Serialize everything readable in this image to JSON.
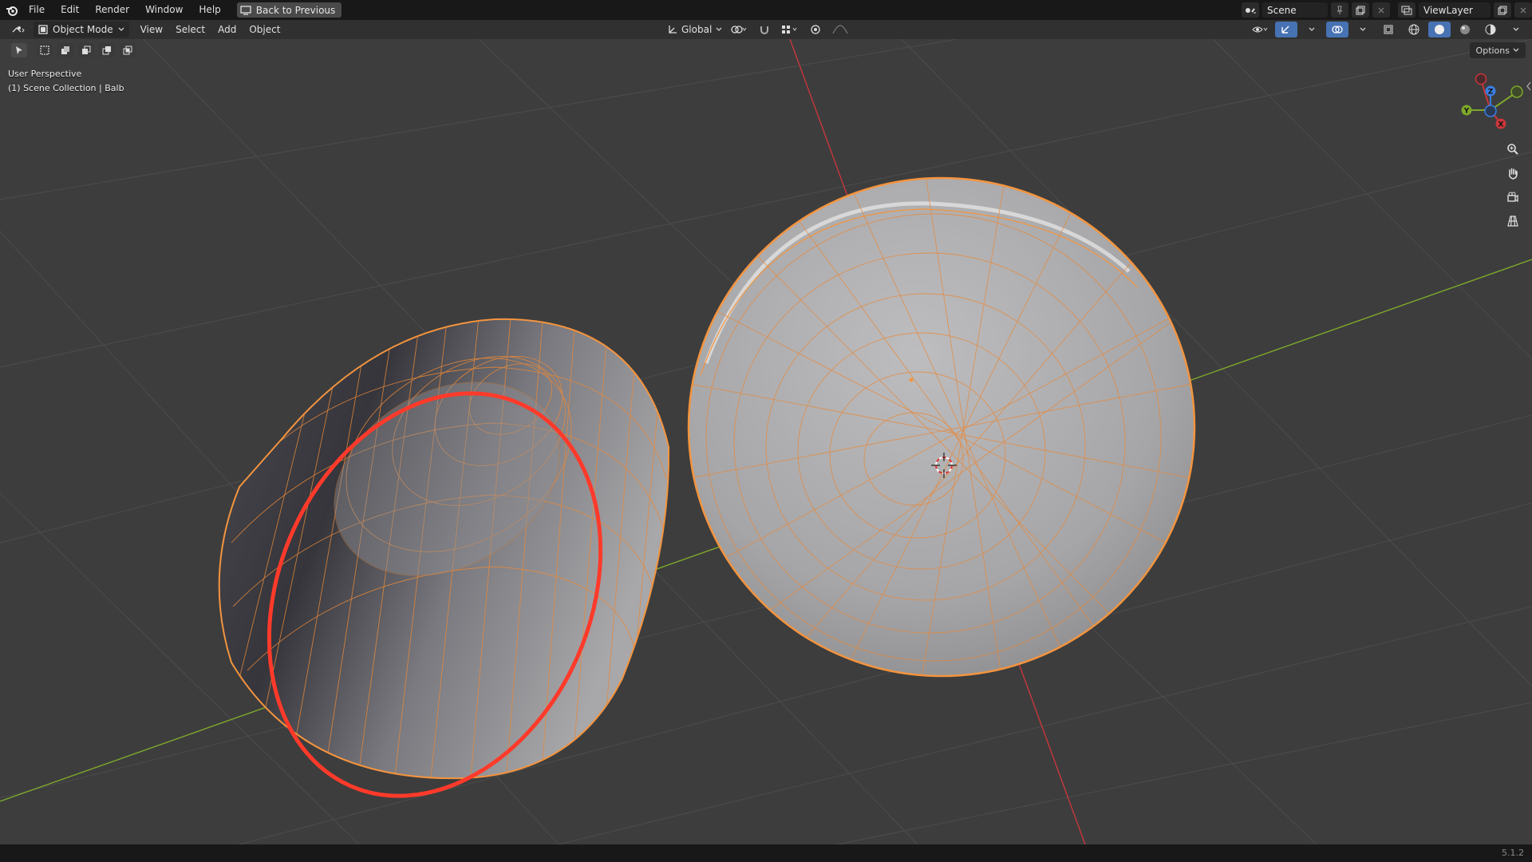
{
  "topbar": {
    "menus": [
      "File",
      "Edit",
      "Render",
      "Window",
      "Help"
    ],
    "back_button": "Back to Previous",
    "scene": "Scene",
    "view_layer": "ViewLayer"
  },
  "header": {
    "mode": "Object Mode",
    "menus": [
      "View",
      "Select",
      "Add",
      "Object"
    ],
    "orientation": "Global"
  },
  "viewport": {
    "perspective": "User Perspective",
    "collection": "(1) Scene Collection | Balb",
    "options": "Options"
  },
  "gizmo": {
    "x": "X",
    "y": "Y",
    "z": "Z"
  },
  "status": {
    "version": "5.1.2"
  },
  "colors": {
    "selection": "#f4943e",
    "active": "#ff3a2a",
    "axis_x": "#c8373b",
    "axis_y": "#7ea82b",
    "axis_z": "#3b7de0"
  }
}
